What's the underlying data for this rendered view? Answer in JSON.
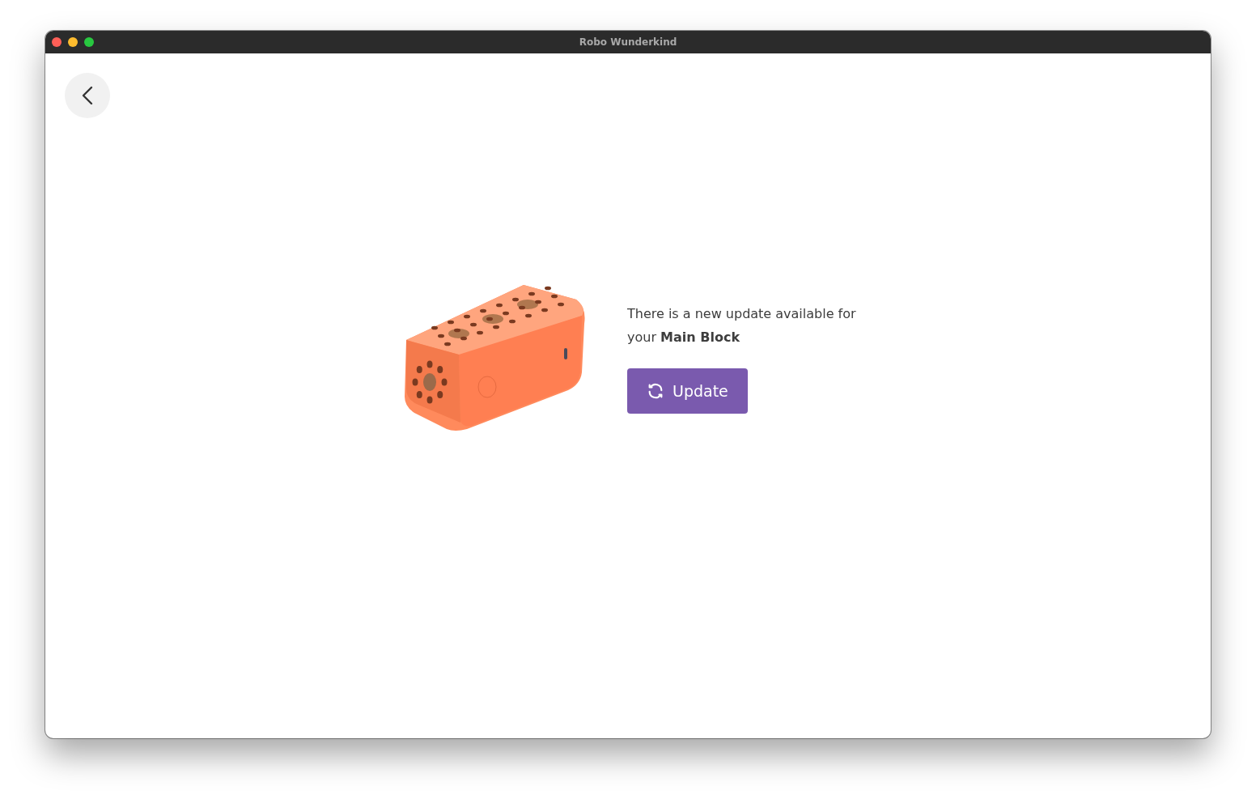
{
  "window": {
    "title": "Robo Wunderkind"
  },
  "message": "There is a new update available for your **Main Block**",
  "update_button": {
    "label": "Update"
  }
}
